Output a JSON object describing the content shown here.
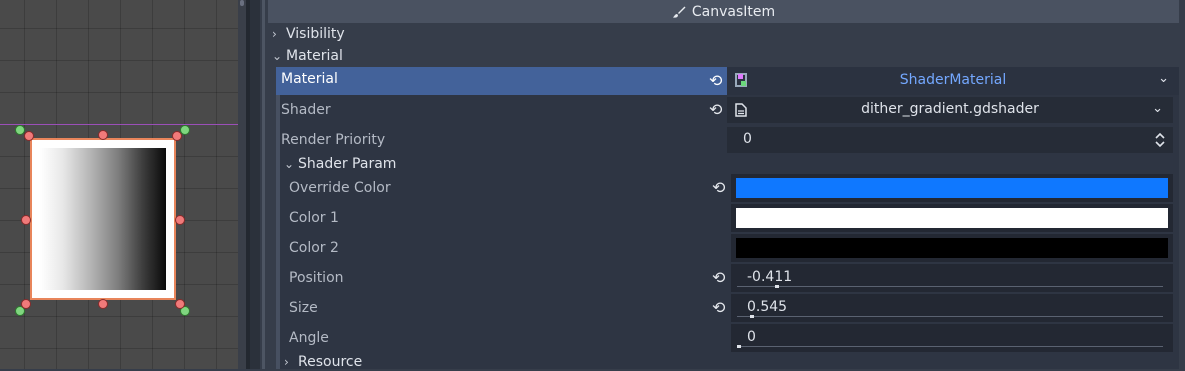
{
  "section": {
    "title": "CanvasItem"
  },
  "groups": {
    "visibility": "Visibility",
    "material": "Material"
  },
  "material": {
    "label": "Material",
    "value": "ShaderMaterial"
  },
  "shader": {
    "label": "Shader",
    "value": "dither_gradient.gdshader"
  },
  "render_priority": {
    "label": "Render Priority",
    "value": "0"
  },
  "shader_param": {
    "title": "Shader Param",
    "override_color": {
      "label": "Override Color",
      "color": "#0f78ff"
    },
    "color1": {
      "label": "Color 1",
      "color": "#ffffff"
    },
    "color2": {
      "label": "Color 2",
      "color": "#000000"
    },
    "position": {
      "label": "Position",
      "value": "-0.411",
      "fraction": 0.09
    },
    "size": {
      "label": "Size",
      "value": "0.545",
      "fraction": 0.03
    },
    "angle": {
      "label": "Angle",
      "value": "0",
      "fraction": 0.0
    }
  },
  "resource": {
    "label": "Resource"
  },
  "icons": {
    "section": "paint-brush-icon",
    "reset": "reload-icon",
    "dropdown": "chevron-down-icon",
    "spin": "up-down-arrows-icon"
  },
  "colors": {
    "accent": "#43629a",
    "link": "#74a8ff"
  }
}
